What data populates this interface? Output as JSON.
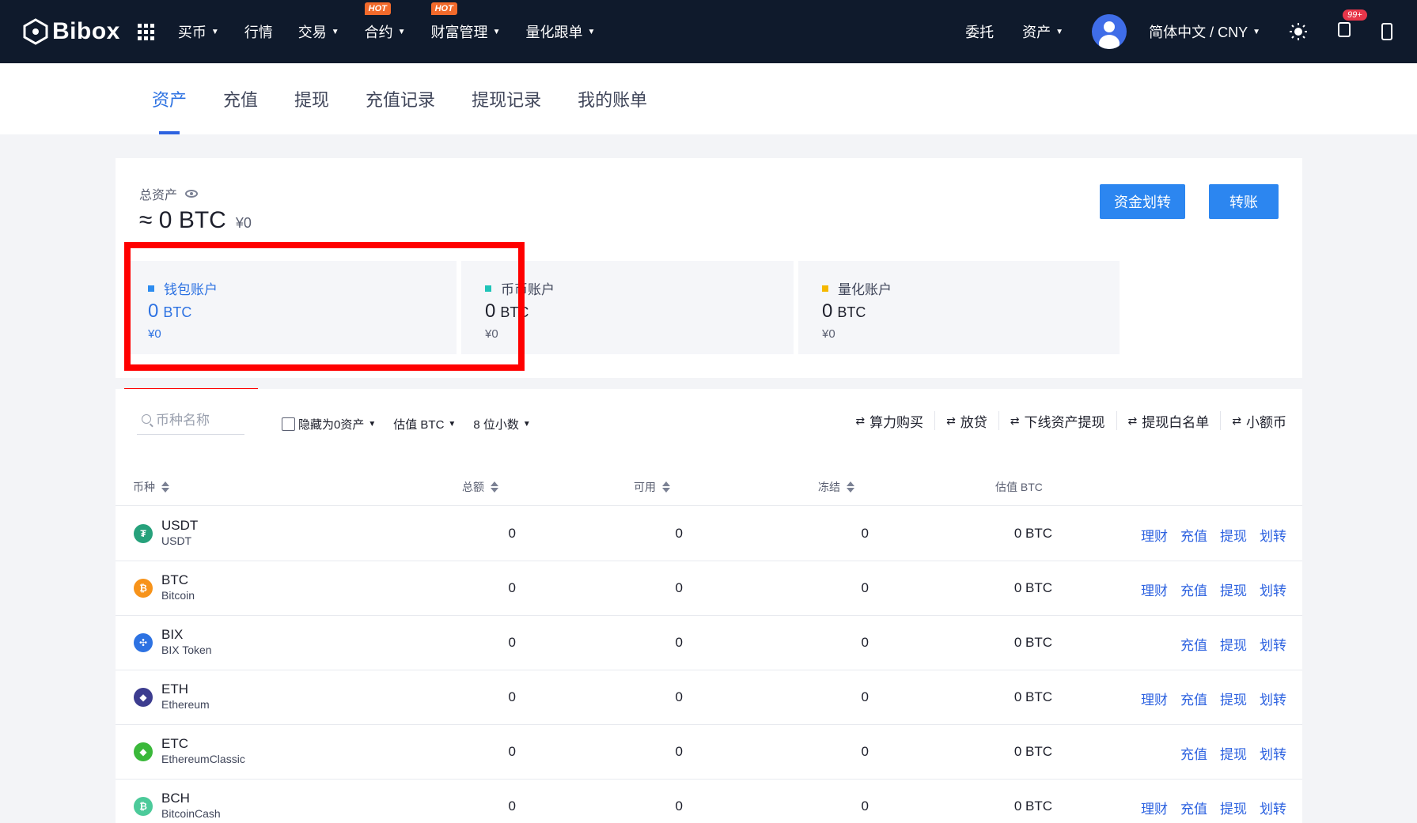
{
  "nav": {
    "logo": "Bibox",
    "items": [
      {
        "label": "买币",
        "caret": true,
        "hot": ""
      },
      {
        "label": "行情",
        "caret": false,
        "hot": ""
      },
      {
        "label": "交易",
        "caret": true,
        "hot": ""
      },
      {
        "label": "合约",
        "caret": true,
        "hot": "HOT"
      },
      {
        "label": "财富管理",
        "caret": true,
        "hot": "HOT"
      },
      {
        "label": "量化跟单",
        "caret": true,
        "hot": ""
      }
    ],
    "right": {
      "orders": "委托",
      "assets": "资产",
      "language": "简体中文 / CNY",
      "notifications_badge": "99+"
    }
  },
  "subtabs": [
    "资产",
    "充值",
    "提现",
    "充值记录",
    "提现记录",
    "我的账单"
  ],
  "summary": {
    "total_label": "总资产",
    "total_value": "≈ 0 BTC",
    "total_cny": "¥0",
    "btn_transfer_funds": "资金划转",
    "btn_transfer": "转账",
    "accounts": [
      {
        "name": "钱包账户",
        "amount": "0",
        "unit": "BTC",
        "cny": "¥0",
        "color": "#2d8cf0"
      },
      {
        "name": "币币账户",
        "amount": "0",
        "unit": "BTC",
        "cny": "¥0",
        "color": "#1fc4b8"
      },
      {
        "name": "量化账户",
        "amount": "0",
        "unit": "BTC",
        "cny": "¥0",
        "color": "#f5b800"
      }
    ]
  },
  "toolbar": {
    "search_placeholder": "币种名称",
    "hide_zero": "隐藏为0资产",
    "valuation": "估值 BTC",
    "decimals": "8 位小数",
    "actions": [
      "算力购买",
      "放贷",
      "下线资产提现",
      "提现白名单",
      "小额币"
    ]
  },
  "table": {
    "headers": {
      "coin": "币种",
      "total": "总额",
      "available": "可用",
      "frozen": "冻结",
      "valuation": "估值 BTC"
    },
    "link_labels": {
      "finance": "理财",
      "deposit": "充值",
      "withdraw": "提现",
      "transfer": "划转"
    },
    "rows": [
      {
        "symbol": "USDT",
        "name": "USDT",
        "total": "0",
        "available": "0",
        "frozen": "0",
        "valuation": "0 BTC",
        "finance": true,
        "icon_color": "#26a17b",
        "icon_glyph": "₮"
      },
      {
        "symbol": "BTC",
        "name": "Bitcoin",
        "total": "0",
        "available": "0",
        "frozen": "0",
        "valuation": "0 BTC",
        "finance": true,
        "icon_color": "#f7931a",
        "icon_glyph": "₿"
      },
      {
        "symbol": "BIX",
        "name": "BIX Token",
        "total": "0",
        "available": "0",
        "frozen": "0",
        "valuation": "0 BTC",
        "finance": false,
        "icon_color": "#2d72e2",
        "icon_glyph": "✣"
      },
      {
        "symbol": "ETH",
        "name": "Ethereum",
        "total": "0",
        "available": "0",
        "frozen": "0",
        "valuation": "0 BTC",
        "finance": true,
        "icon_color": "#3c3c8f",
        "icon_glyph": "◆"
      },
      {
        "symbol": "ETC",
        "name": "EthereumClassic",
        "total": "0",
        "available": "0",
        "frozen": "0",
        "valuation": "0 BTC",
        "finance": false,
        "icon_color": "#3ab83a",
        "icon_glyph": "◆"
      },
      {
        "symbol": "BCH",
        "name": "BitcoinCash",
        "total": "0",
        "available": "0",
        "frozen": "0",
        "valuation": "0 BTC",
        "finance": true,
        "icon_color": "#4cca9a",
        "icon_glyph": "₿"
      }
    ]
  }
}
